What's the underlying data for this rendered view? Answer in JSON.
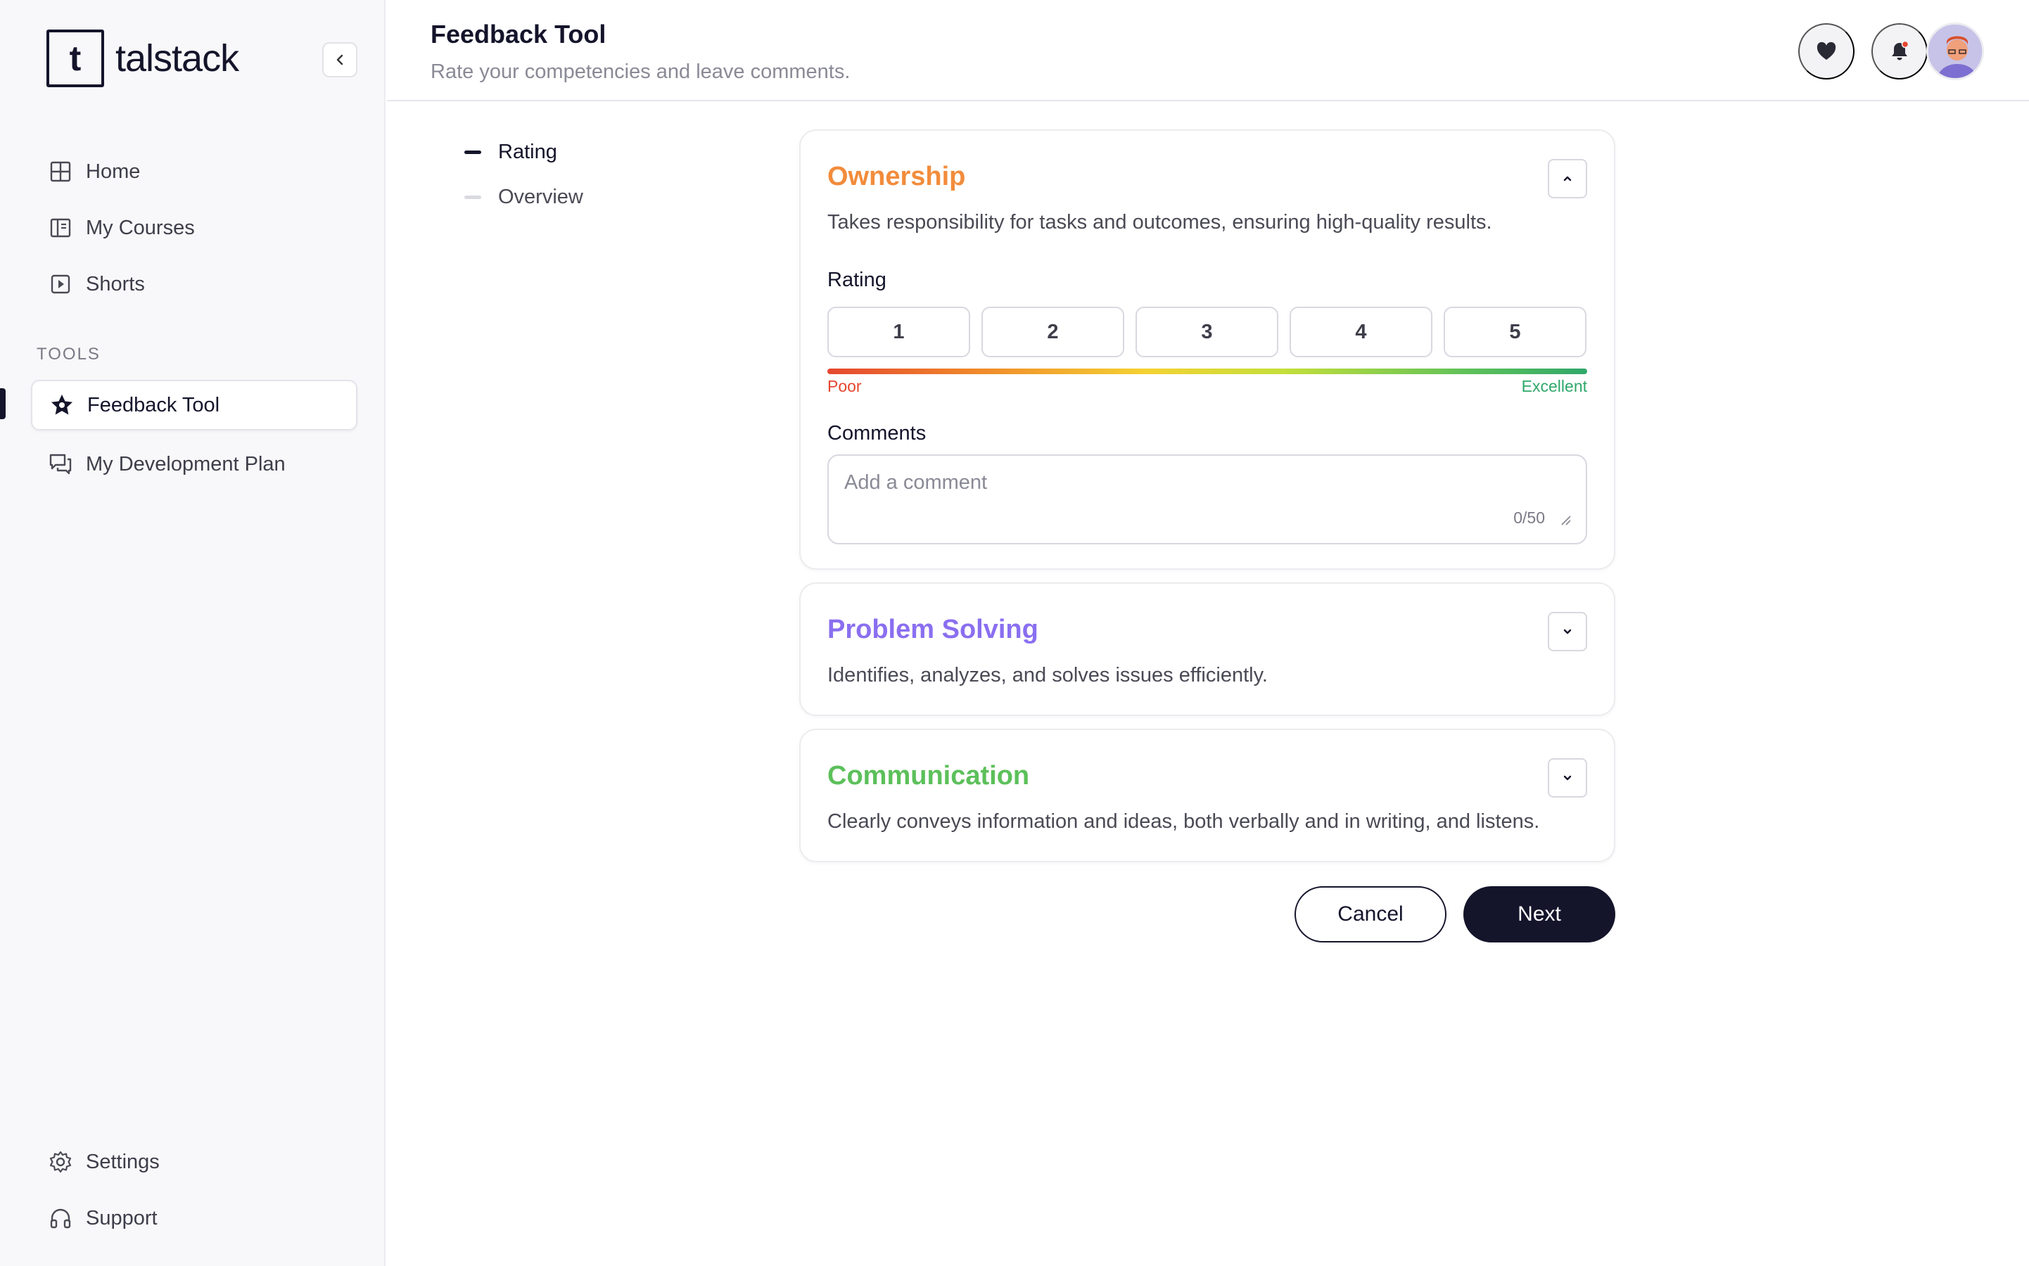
{
  "app": {
    "logo_text": "talstack",
    "logo_glyph": "t"
  },
  "sidebar": {
    "main_items": [
      {
        "label": "Home",
        "icon": "grid-icon"
      },
      {
        "label": "My Courses",
        "icon": "book-icon"
      },
      {
        "label": "Shorts",
        "icon": "play-square-icon"
      }
    ],
    "tools_label": "TOOLS",
    "tool_items": [
      {
        "label": "Feedback Tool",
        "icon": "star-badge-icon",
        "active": true
      },
      {
        "label": "My Development Plan",
        "icon": "chat-icon",
        "active": false
      }
    ],
    "bottom_items": [
      {
        "label": "Settings",
        "icon": "gear-icon"
      },
      {
        "label": "Support",
        "icon": "headphones-icon"
      }
    ]
  },
  "header": {
    "title": "Feedback Tool",
    "subtitle": "Rate your competencies and leave comments.",
    "has_notification": true
  },
  "steps": [
    {
      "label": "Rating",
      "active": true
    },
    {
      "label": "Overview",
      "active": false
    }
  ],
  "competencies": [
    {
      "title": "Ownership",
      "color": "#f28c3c",
      "description": "Takes responsibility for tasks and outcomes, ensuring high-quality results.",
      "expanded": true,
      "rating_label": "Rating",
      "rating_options": [
        "1",
        "2",
        "3",
        "4",
        "5"
      ],
      "scale_low": "Poor",
      "scale_high": "Excellent",
      "comments_label": "Comments",
      "comment_placeholder": "Add a comment",
      "comment_value": "",
      "comment_counter": "0/50"
    },
    {
      "title": "Problem Solving",
      "color": "#8a6ff0",
      "description": "Identifies, analyzes, and solves issues efficiently.",
      "expanded": false
    },
    {
      "title": "Communication",
      "color": "#5cc05a",
      "description": "Clearly conveys information and ideas, both verbally and in writing, and listens.",
      "expanded": false
    }
  ],
  "actions": {
    "cancel_label": "Cancel",
    "next_label": "Next"
  }
}
